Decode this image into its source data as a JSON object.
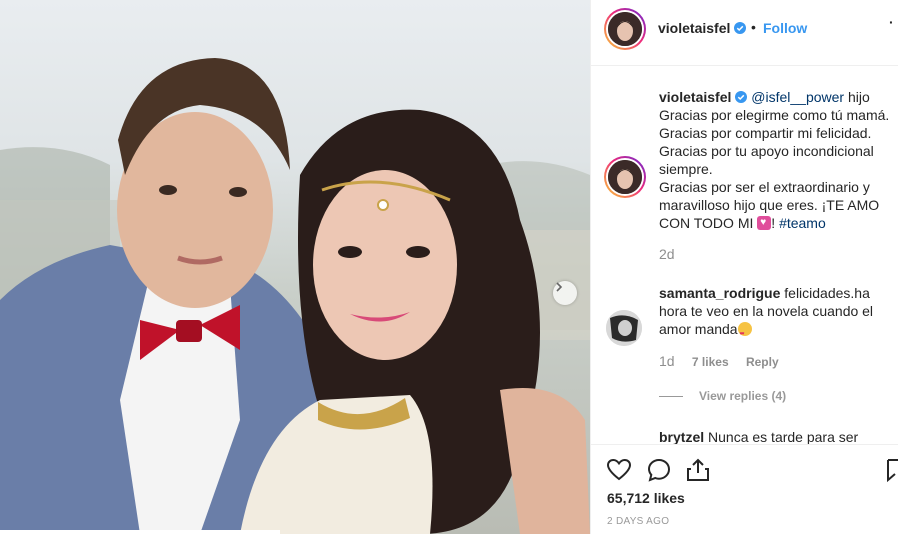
{
  "post": {
    "username": "violetaisfel",
    "verified": true,
    "follow_label": "Follow",
    "separator": "•",
    "more_label": "·"
  },
  "caption": {
    "username": "violetaisfel",
    "mention": "@isfel__power",
    "line1_rest": " hijo",
    "line2": "Gracias por elegirme como tú mamá.",
    "line3": "Gracias por compartir mi felicidad.",
    "line4": "Gracias por tu apoyo incondicional siempre.",
    "line5": "Gracias por ser el extraordinario y maravilloso hijo que eres. ¡TE AMO CON TODO MI",
    "after_emoji": "! ",
    "hashtag": "#teamo",
    "time": "2d"
  },
  "comments": [
    {
      "username": "samanta_rodrigue",
      "text": " felicidades.ha hora te veo en la novela cuando el amor manda",
      "time": "1d",
      "likes": "7 likes",
      "reply_label": "Reply",
      "view_replies": "View replies (4)"
    },
    {
      "username": "brytzel",
      "text": " Nunca es tarde para ser"
    }
  ],
  "footer": {
    "likes": "65,712 likes",
    "date": "2 DAYS AGO"
  },
  "icons": {
    "like": "heart-outline-icon",
    "comment": "speech-bubble-icon",
    "share": "share-icon",
    "save": "bookmark-icon",
    "next": "chevron-right-icon"
  },
  "colors": {
    "link": "#3897f0",
    "mention": "#003569",
    "verified": "#3897f0",
    "muted": "#8e8e8e"
  }
}
